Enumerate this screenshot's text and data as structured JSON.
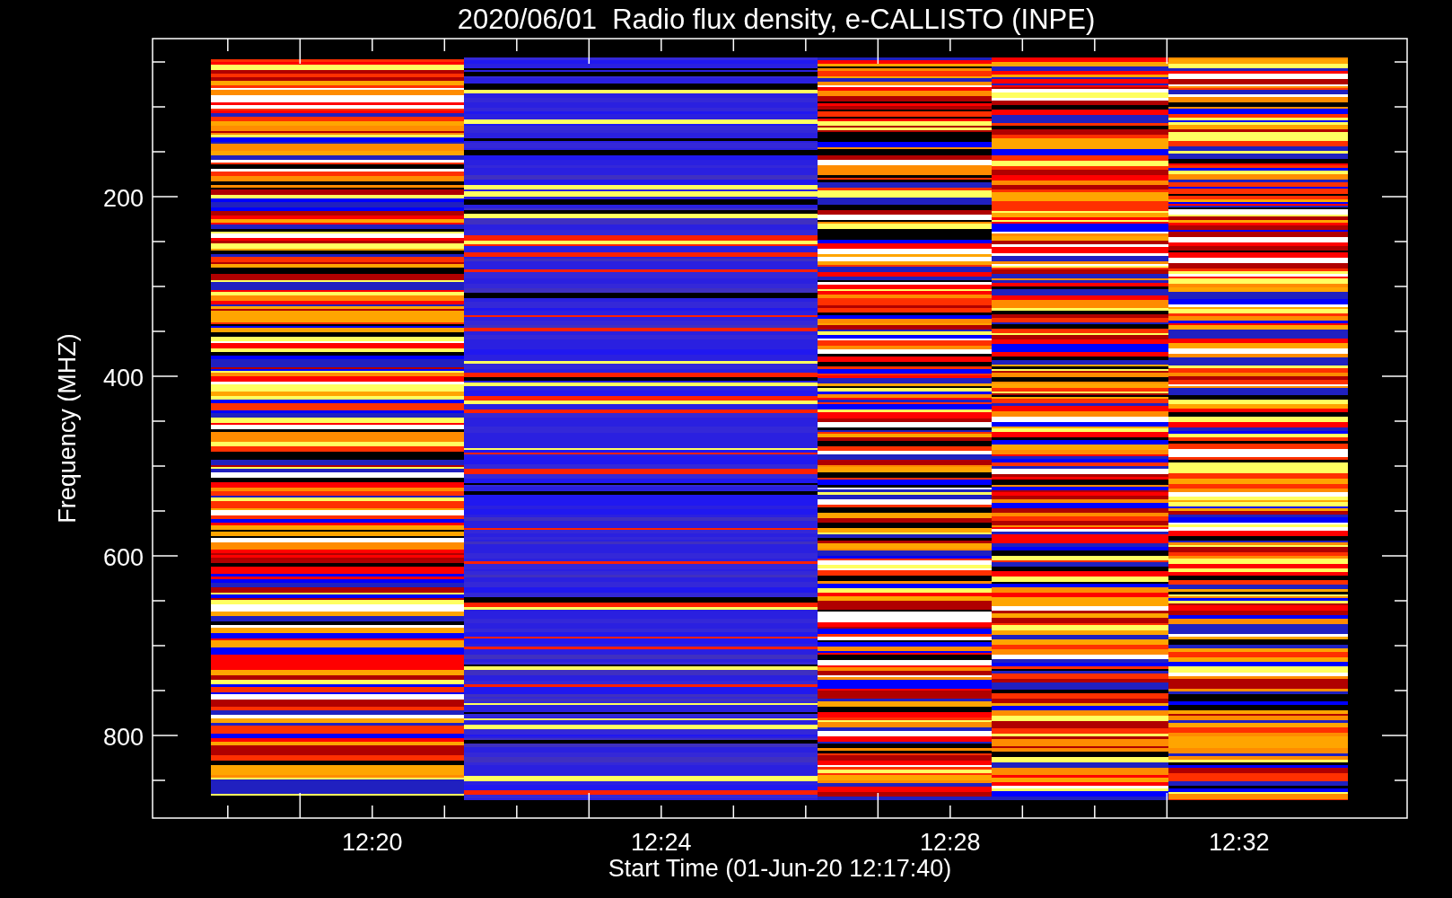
{
  "title": "2020/06/01  Radio flux density, e-CALLISTO (INPE)",
  "y_axis": {
    "label": "Frequency (MHZ)",
    "ticks": [
      "200",
      "400",
      "600",
      "800"
    ]
  },
  "x_axis": {
    "label": "Start Time (01-Jun-20 12:17:40)",
    "ticks": [
      "12:20",
      "12:24",
      "12:28",
      "12:32"
    ]
  }
}
